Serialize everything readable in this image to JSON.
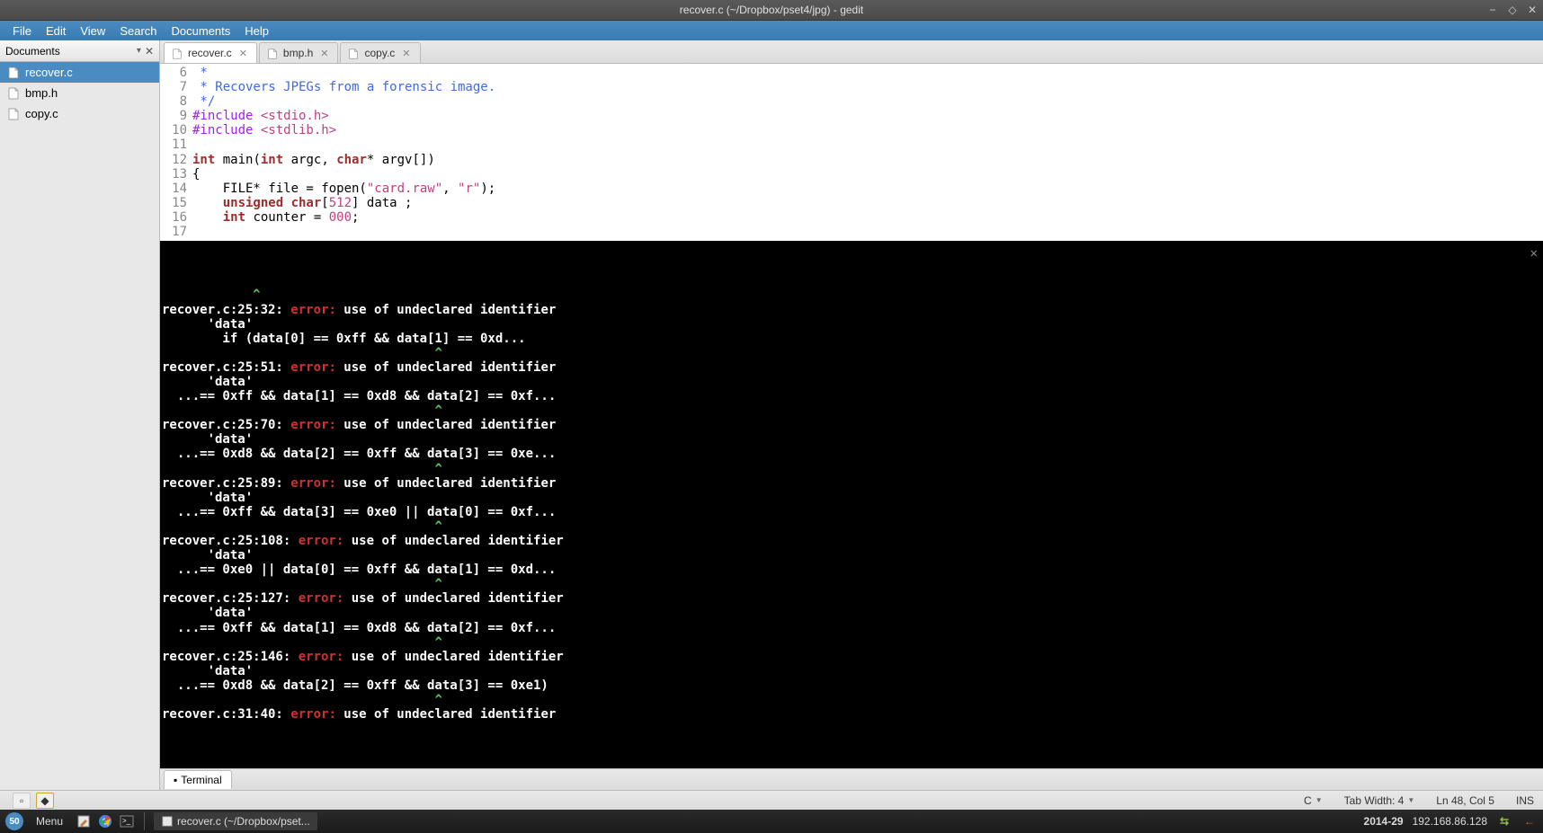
{
  "window": {
    "title": "recover.c (~/Dropbox/pset4/jpg) - gedit"
  },
  "menubar": [
    "File",
    "Edit",
    "View",
    "Search",
    "Documents",
    "Help"
  ],
  "sidepanel": {
    "title": "Documents",
    "items": [
      {
        "label": "recover.c",
        "selected": true
      },
      {
        "label": "bmp.h",
        "selected": false
      },
      {
        "label": "copy.c",
        "selected": false
      }
    ]
  },
  "tabs": [
    {
      "label": "recover.c",
      "active": true
    },
    {
      "label": "bmp.h",
      "active": false
    },
    {
      "label": "copy.c",
      "active": false
    }
  ],
  "code": [
    {
      "n": 6,
      "segs": [
        {
          "c": "cmt",
          "t": " *"
        }
      ]
    },
    {
      "n": 7,
      "segs": [
        {
          "c": "cmt",
          "t": " * Recovers JPEGs from a forensic image."
        }
      ]
    },
    {
      "n": 8,
      "segs": [
        {
          "c": "cmt",
          "t": " */"
        }
      ]
    },
    {
      "n": 9,
      "segs": [
        {
          "c": "pp",
          "t": "#include "
        },
        {
          "c": "str",
          "t": "<stdio.h>"
        }
      ]
    },
    {
      "n": 10,
      "segs": [
        {
          "c": "pp",
          "t": "#include "
        },
        {
          "c": "str",
          "t": "<stdlib.h>"
        }
      ]
    },
    {
      "n": 11,
      "segs": []
    },
    {
      "n": 12,
      "segs": [
        {
          "c": "kw",
          "t": "int"
        },
        {
          "c": "",
          "t": " main("
        },
        {
          "c": "kw",
          "t": "int"
        },
        {
          "c": "",
          "t": " argc, "
        },
        {
          "c": "kw",
          "t": "char"
        },
        {
          "c": "",
          "t": "* argv[])"
        }
      ]
    },
    {
      "n": 13,
      "segs": [
        {
          "c": "",
          "t": "{"
        }
      ]
    },
    {
      "n": 14,
      "segs": [
        {
          "c": "",
          "t": "    FILE* file = fopen("
        },
        {
          "c": "str",
          "t": "\"card.raw\""
        },
        {
          "c": "",
          "t": ", "
        },
        {
          "c": "str",
          "t": "\"r\""
        },
        {
          "c": "",
          "t": ");"
        }
      ]
    },
    {
      "n": 15,
      "segs": [
        {
          "c": "",
          "t": "    "
        },
        {
          "c": "kw",
          "t": "unsigned char"
        },
        {
          "c": "",
          "t": "["
        },
        {
          "c": "num",
          "t": "512"
        },
        {
          "c": "",
          "t": "] data ;"
        }
      ]
    },
    {
      "n": 16,
      "segs": [
        {
          "c": "",
          "t": "    "
        },
        {
          "c": "kw",
          "t": "int"
        },
        {
          "c": "",
          "t": " counter = "
        },
        {
          "c": "num",
          "t": "000"
        },
        {
          "c": "",
          "t": ";"
        }
      ]
    },
    {
      "n": 17,
      "segs": []
    }
  ],
  "terminal": [
    [
      {
        "t": "            ",
        "c": ""
      },
      {
        "t": "^",
        "c": "lime"
      }
    ],
    [
      {
        "t": "recover.c:25:32: ",
        "c": "w"
      },
      {
        "t": "error:",
        "c": "err"
      },
      {
        "t": " use of undeclared identifier",
        "c": "w"
      }
    ],
    [
      {
        "t": "      'data'",
        "c": "w"
      }
    ],
    [
      {
        "t": "        if (data[0] == 0xff && data[1] == 0xd...",
        "c": ""
      }
    ],
    [
      {
        "t": "                                    ",
        "c": ""
      },
      {
        "t": "^",
        "c": "lime"
      }
    ],
    [
      {
        "t": "recover.c:25:51: ",
        "c": "w"
      },
      {
        "t": "error:",
        "c": "err"
      },
      {
        "t": " use of undeclared identifier",
        "c": "w"
      }
    ],
    [
      {
        "t": "      'data'",
        "c": "w"
      }
    ],
    [
      {
        "t": "  ...== 0xff && data[1] == 0xd8 && data[2] == 0xf...",
        "c": ""
      }
    ],
    [
      {
        "t": "                                    ",
        "c": ""
      },
      {
        "t": "^",
        "c": "lime"
      }
    ],
    [
      {
        "t": "recover.c:25:70: ",
        "c": "w"
      },
      {
        "t": "error:",
        "c": "err"
      },
      {
        "t": " use of undeclared identifier",
        "c": "w"
      }
    ],
    [
      {
        "t": "      'data'",
        "c": "w"
      }
    ],
    [
      {
        "t": "  ...== 0xd8 && data[2] == 0xff && data[3] == 0xe...",
        "c": ""
      }
    ],
    [
      {
        "t": "                                    ",
        "c": ""
      },
      {
        "t": "^",
        "c": "lime"
      }
    ],
    [
      {
        "t": "recover.c:25:89: ",
        "c": "w"
      },
      {
        "t": "error:",
        "c": "err"
      },
      {
        "t": " use of undeclared identifier",
        "c": "w"
      }
    ],
    [
      {
        "t": "      'data'",
        "c": "w"
      }
    ],
    [
      {
        "t": "  ...== 0xff && data[3] == 0xe0 || data[0] == 0xf...",
        "c": ""
      }
    ],
    [
      {
        "t": "                                    ",
        "c": ""
      },
      {
        "t": "^",
        "c": "lime"
      }
    ],
    [
      {
        "t": "recover.c:25:108: ",
        "c": "w"
      },
      {
        "t": "error:",
        "c": "err"
      },
      {
        "t": " use of undeclared identifier",
        "c": "w"
      }
    ],
    [
      {
        "t": "      'data'",
        "c": "w"
      }
    ],
    [
      {
        "t": "  ...== 0xe0 || data[0] == 0xff && data[1] == 0xd...",
        "c": ""
      }
    ],
    [
      {
        "t": "                                    ",
        "c": ""
      },
      {
        "t": "^",
        "c": "lime"
      }
    ],
    [
      {
        "t": "recover.c:25:127: ",
        "c": "w"
      },
      {
        "t": "error:",
        "c": "err"
      },
      {
        "t": " use of undeclared identifier",
        "c": "w"
      }
    ],
    [
      {
        "t": "      'data'",
        "c": "w"
      }
    ],
    [
      {
        "t": "  ...== 0xff && data[1] == 0xd8 && data[2] == 0xf...",
        "c": ""
      }
    ],
    [
      {
        "t": "                                    ",
        "c": ""
      },
      {
        "t": "^",
        "c": "lime"
      }
    ],
    [
      {
        "t": "recover.c:25:146: ",
        "c": "w"
      },
      {
        "t": "error:",
        "c": "err"
      },
      {
        "t": " use of undeclared identifier",
        "c": "w"
      }
    ],
    [
      {
        "t": "      'data'",
        "c": "w"
      }
    ],
    [
      {
        "t": "  ...== 0xd8 && data[2] == 0xff && data[3] == 0xe1)",
        "c": ""
      }
    ],
    [
      {
        "t": "                                    ",
        "c": ""
      },
      {
        "t": "^",
        "c": "lime"
      }
    ],
    [
      {
        "t": "recover.c:31:40: ",
        "c": "w"
      },
      {
        "t": "error:",
        "c": "err"
      },
      {
        "t": " use of undeclared identifier",
        "c": "w"
      }
    ]
  ],
  "terminal_tab": "Terminal",
  "statusbar": {
    "lang": "C",
    "tabwidth": "Tab Width: 4",
    "position": "Ln 48, Col 5",
    "mode": "INS"
  },
  "taskbar": {
    "circle": "50",
    "menu_label": "Menu",
    "window_title": "recover.c (~/Dropbox/pset...",
    "time": "2014-29",
    "ip": "192.168.86.128"
  }
}
